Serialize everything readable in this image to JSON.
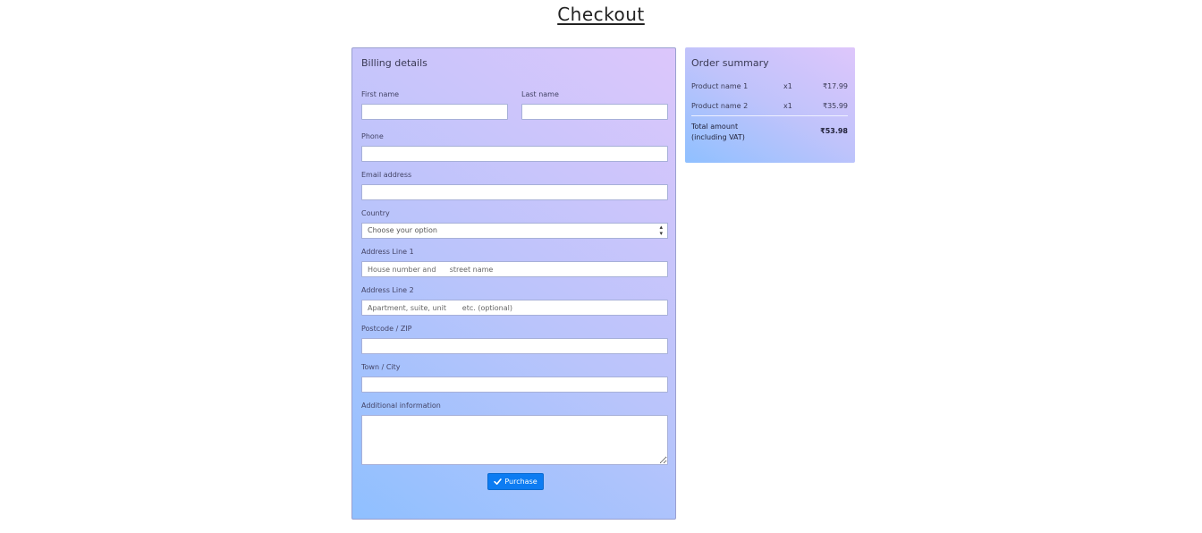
{
  "page": {
    "title": "Checkout"
  },
  "billing": {
    "title": "Billing details",
    "first_name": {
      "label": "First name",
      "value": "",
      "placeholder": ""
    },
    "last_name": {
      "label": "Last name",
      "value": "",
      "placeholder": ""
    },
    "phone": {
      "label": "Phone",
      "value": "",
      "placeholder": ""
    },
    "email": {
      "label": "Email address",
      "value": "",
      "placeholder": ""
    },
    "country": {
      "label": "Country",
      "selected": "Choose your option"
    },
    "address1": {
      "label": "Address Line 1",
      "placeholder": "House number and      street name"
    },
    "address2": {
      "label": "Address Line 2",
      "placeholder": "Apartment, suite, unit       etc. (optional)"
    },
    "postcode": {
      "label": "Postcode / ZIP",
      "placeholder": ""
    },
    "town": {
      "label": "Town / City",
      "placeholder": ""
    },
    "additional": {
      "label": "Additional information",
      "placeholder": ""
    },
    "purchase_label": "Purchase",
    "purchase_icon": "check-icon"
  },
  "summary": {
    "title": "Order summary",
    "items": [
      {
        "name": "Product name 1",
        "qty": "x1",
        "price": "₹17.99"
      },
      {
        "name": "Product name 2",
        "qty": "x1",
        "price": "₹35.99"
      }
    ],
    "total_label": "Total amount (including VAT)",
    "total_value": "₹53.98"
  },
  "colors": {
    "accent_button": "#0d7cf2",
    "card_gradient_start": "#8fc0ff",
    "card_gradient_end": "#dcc6fb"
  }
}
